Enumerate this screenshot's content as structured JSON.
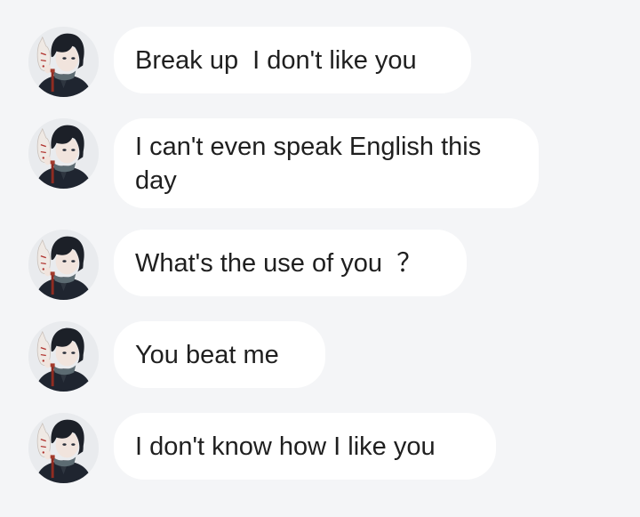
{
  "messages": [
    {
      "text": "Break up  I don't like you"
    },
    {
      "text": "I can't even speak English this day"
    },
    {
      "text": "What's the use of you  ？"
    },
    {
      "text": "You beat me"
    },
    {
      "text": "I don't know how I like you"
    }
  ],
  "avatar_icon": "anime-character-with-fox-mask-avatar",
  "colors": {
    "background": "#f4f5f7",
    "bubble": "#ffffff",
    "text": "#1f1f1f",
    "hair": "#1c2028",
    "mask": "#efe9e4",
    "mask_accent": "#b0322d",
    "tassel": "#8f2c22"
  }
}
